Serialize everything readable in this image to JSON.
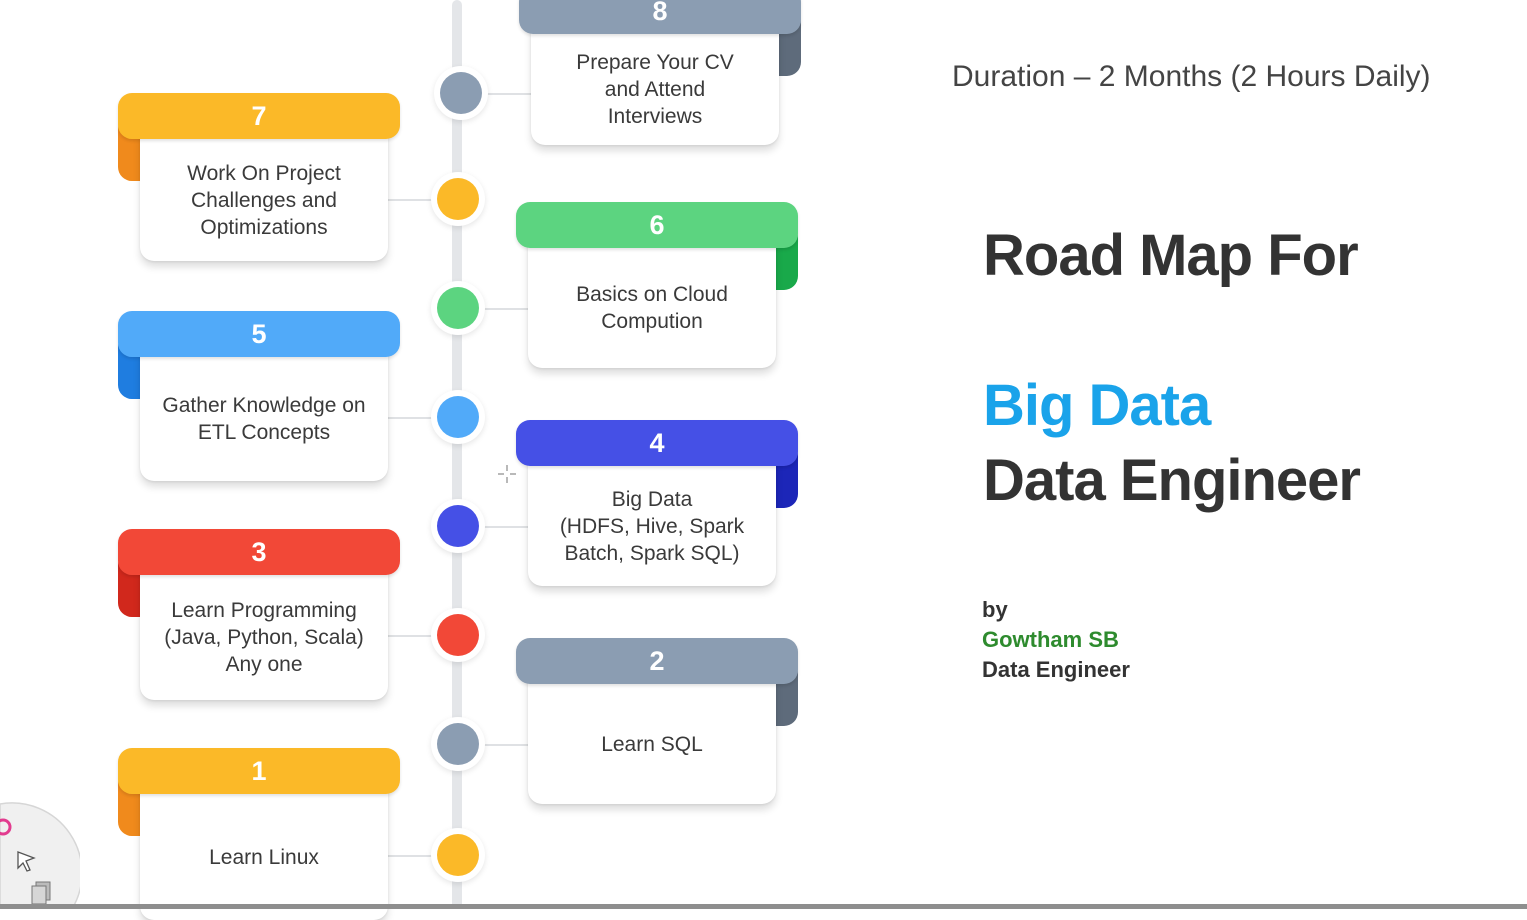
{
  "header": {
    "duration": "Duration – 2 Months (2 Hours Daily)"
  },
  "title": {
    "line1": "Road Map For",
    "line2": "Big Data",
    "line3": "Data Engineer"
  },
  "byline": {
    "by": "by",
    "author": "Gowtham SB",
    "role": "Data Engineer"
  },
  "colors": {
    "accent_blue": "#1aa3ea",
    "author_green": "#2e8b2e",
    "yellow": "#fbb928",
    "orange": "#f08a1c",
    "green": "#5cd480",
    "dark_green": "#19a94a",
    "light_blue": "#51aaf9",
    "mid_blue": "#1f7de0",
    "indigo": "#4550e6",
    "dark_indigo": "#1c26b8",
    "red": "#f24837",
    "dark_red": "#d1281c",
    "slate": "#8b9db2",
    "dark_slate": "#5e6b7b"
  },
  "steps": [
    {
      "number": "1",
      "text": "Learn Linux",
      "color": "#fbb928",
      "fold_color": "#f08a1c",
      "side": "left"
    },
    {
      "number": "2",
      "text": "Learn SQL",
      "color": "#8b9db2",
      "fold_color": "#5e6b7b",
      "side": "right"
    },
    {
      "number": "3",
      "text": "Learn Programming\n(Java, Python, Scala)\nAny one",
      "color": "#f24837",
      "fold_color": "#d1281c",
      "side": "left"
    },
    {
      "number": "4",
      "text": "Big Data\n(HDFS, Hive, Spark\nBatch, Spark SQL)",
      "color": "#4550e6",
      "fold_color": "#1c26b8",
      "side": "right"
    },
    {
      "number": "5",
      "text": "Gather Knowledge on\nETL Concepts",
      "color": "#51aaf9",
      "fold_color": "#1f7de0",
      "side": "left"
    },
    {
      "number": "6",
      "text": "Basics on Cloud\nCompution",
      "color": "#5cd480",
      "fold_color": "#19a94a",
      "side": "right"
    },
    {
      "number": "7",
      "text": "Work On Project\nChallenges and\nOptimizations",
      "color": "#fbb928",
      "fold_color": "#f08a1c",
      "side": "left"
    },
    {
      "number": "8",
      "text": "Prepare Your CV\nand Attend\nInterviews",
      "color": "#8b9db2",
      "fold_color": "#5e6b7b",
      "side": "right"
    }
  ],
  "icons": {
    "cursor": "move-cursor-icon",
    "tool": "pen-tool-icon"
  }
}
